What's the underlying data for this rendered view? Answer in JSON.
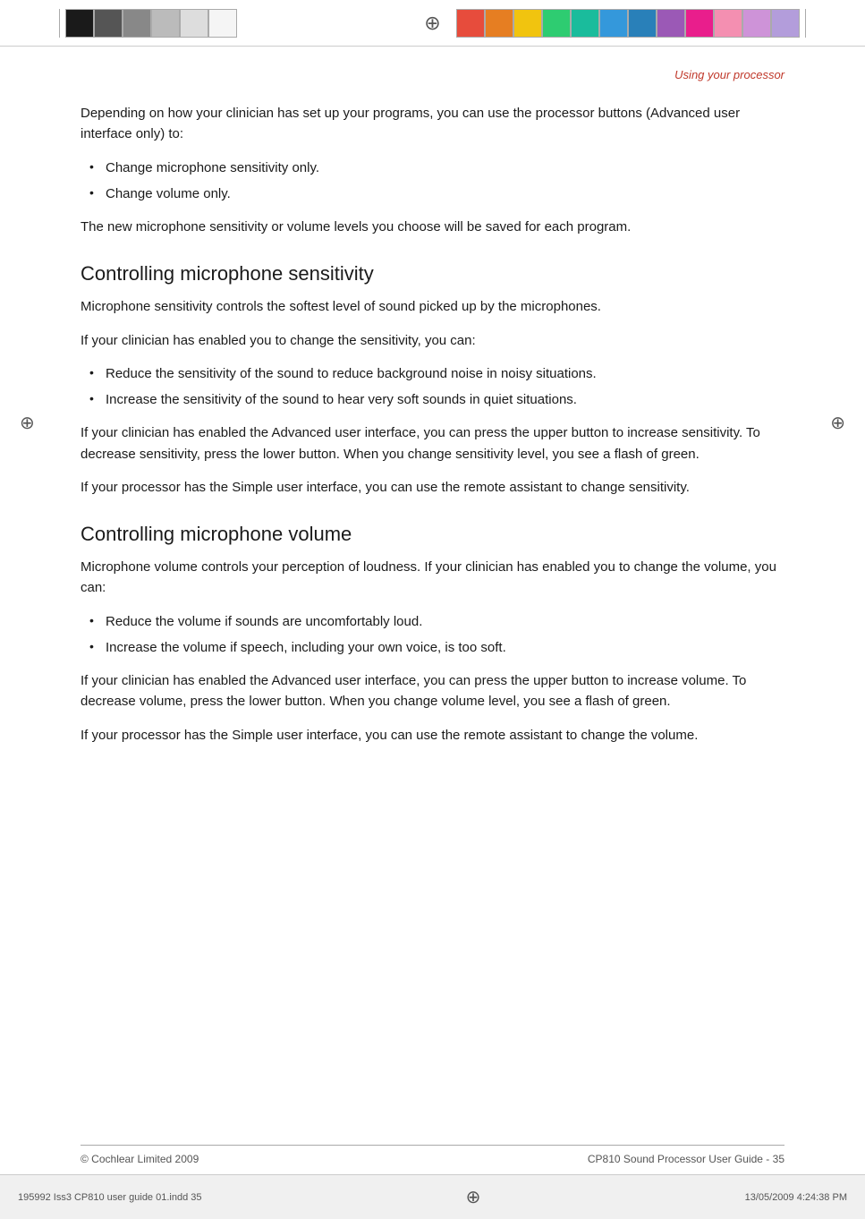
{
  "header": {
    "compass_symbol": "⊕",
    "left_blocks": [
      {
        "color": "cb-black"
      },
      {
        "color": "cb-dark-gray"
      },
      {
        "color": "cb-mid-gray"
      },
      {
        "color": "cb-light-gray"
      },
      {
        "color": "cb-very-light"
      },
      {
        "color": "cb-white"
      }
    ],
    "right_blocks": [
      {
        "color": "cb-red"
      },
      {
        "color": "cb-orange"
      },
      {
        "color": "cb-yellow"
      },
      {
        "color": "cb-green"
      },
      {
        "color": "cb-teal"
      },
      {
        "color": "cb-blue"
      },
      {
        "color": "cb-indigo"
      },
      {
        "color": "cb-purple"
      },
      {
        "color": "cb-pink"
      },
      {
        "color": "cb-light-pink"
      },
      {
        "color": "cb-mauve"
      },
      {
        "color": "cb-lavender"
      }
    ]
  },
  "section_header": "Using your processor",
  "paragraphs": {
    "intro": "Depending on how your clinician has set up your programs, you can use the processor buttons (Advanced user interface only) to:",
    "intro_bullets": [
      "Change microphone sensitivity only.",
      "Change volume only."
    ],
    "new_levels": "The new microphone sensitivity or volume levels you choose will be saved for each program.",
    "sensitivity_heading": "Controlling microphone sensitivity",
    "sensitivity_p1": "Microphone sensitivity controls the softest level of sound picked up by the microphones.",
    "sensitivity_p2": "If your clinician has enabled you to change the sensitivity, you can:",
    "sensitivity_bullets": [
      "Reduce the sensitivity of the sound to reduce background noise in noisy situations.",
      "Increase the sensitivity of the sound to hear very soft sounds in quiet situations."
    ],
    "sensitivity_p3": "If your clinician has enabled the Advanced user interface, you can press the upper button to increase sensitivity. To decrease sensitivity, press the lower button. When you change sensitivity level, you see a flash of green.",
    "sensitivity_p4": "If your processor has the Simple user interface, you can use the remote assistant to change sensitivity.",
    "volume_heading": "Controlling microphone volume",
    "volume_p1": "Microphone volume controls your perception of loudness. If your clinician has enabled you to change the volume, you can:",
    "volume_bullets": [
      "Reduce the volume if sounds are uncomfortably loud.",
      "Increase the volume if speech, including your own voice, is too soft."
    ],
    "volume_p2": "If your clinician has enabled the Advanced user interface, you can press the upper button to increase volume. To decrease volume, press the lower button. When you change volume level, you see a flash of green.",
    "volume_p3": "If your processor has the Simple user interface, you can use the remote assistant to change the volume."
  },
  "footer": {
    "left": "© Cochlear Limited 2009",
    "right": "CP810 Sound Processor User Guide  - 35"
  },
  "bottom_bar": {
    "left": "195992 Iss3 CP810 user guide 01.indd  35",
    "center_symbol": "⊕",
    "right": "13/05/2009  4:24:38 PM"
  },
  "margin_compass": "⊕"
}
